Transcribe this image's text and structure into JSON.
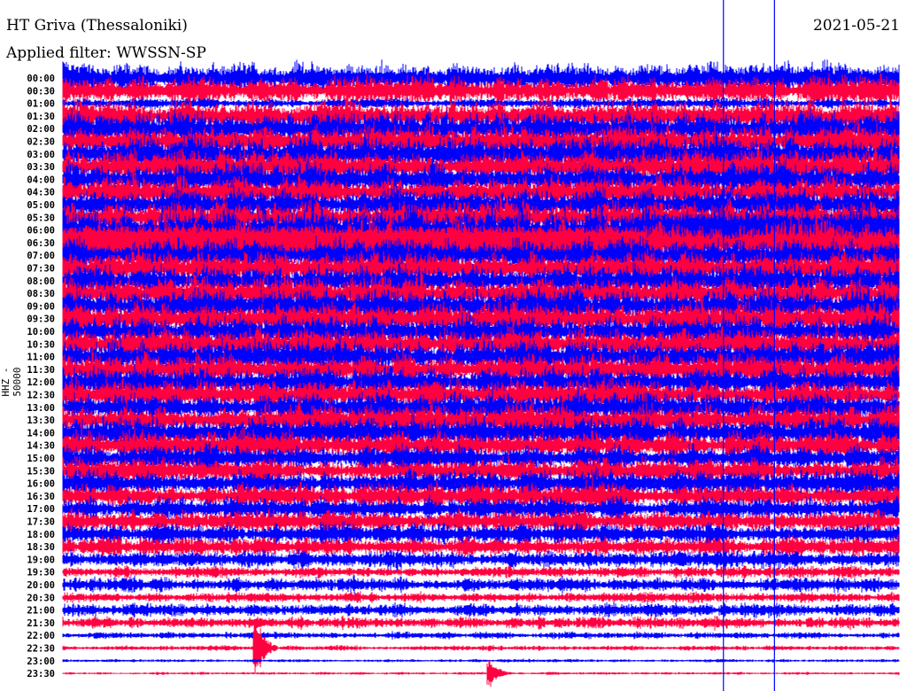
{
  "header": {
    "station": "HT Griva (Thessaloniki)",
    "date": "2021-05-21",
    "filter": "Applied filter: WWSSN-SP"
  },
  "chart_data": {
    "type": "helicorder",
    "title": "HT Griva (Thessaloniki)",
    "ylabel": "HHZ - 50000",
    "row_minutes": 30,
    "colors": {
      "odd": "#0000ff",
      "even": "#ff0040",
      "marker": "#0000ff"
    },
    "tick_labels": [
      "00:00",
      "00:30",
      "01:00",
      "01:30",
      "02:00",
      "02:30",
      "03:00",
      "03:30",
      "04:00",
      "04:30",
      "05:00",
      "05:30",
      "06:00",
      "06:30",
      "07:00",
      "07:30",
      "08:00",
      "08:30",
      "09:00",
      "09:30",
      "10:00",
      "10:30",
      "11:00",
      "11:30",
      "12:00",
      "12:30",
      "13:00",
      "13:30",
      "14:00",
      "14:30",
      "15:00",
      "15:30",
      "16:00",
      "16:30",
      "17:00",
      "17:30",
      "18:00",
      "18:30",
      "19:00",
      "19:30",
      "20:00",
      "20:30",
      "21:00",
      "21:30",
      "22:00",
      "22:30",
      "23:00",
      "23:30"
    ],
    "relative_amplitude": [
      0.9,
      0.85,
      0.3,
      0.95,
      1.0,
      1.0,
      1.05,
      1.0,
      1.0,
      0.95,
      1.0,
      1.0,
      1.3,
      1.3,
      1.0,
      1.0,
      0.95,
      1.0,
      1.0,
      1.0,
      0.95,
      0.95,
      0.95,
      0.95,
      0.9,
      0.9,
      0.9,
      0.9,
      0.95,
      0.85,
      0.8,
      0.8,
      0.8,
      0.75,
      0.7,
      0.7,
      0.65,
      0.6,
      0.5,
      0.35,
      0.45,
      0.3,
      0.4,
      0.35,
      0.2,
      0.15,
      0.1,
      0.08
    ],
    "events": [
      {
        "row": "22:30",
        "fraction": 0.23,
        "amplitude": 1.2
      },
      {
        "row": "23:30",
        "fraction": 0.51,
        "amplitude": 0.6
      },
      {
        "row": "00:00",
        "fraction": 0.0,
        "amplitude": 0.9
      }
    ],
    "time_markers_fraction": [
      0.79,
      0.851
    ]
  }
}
